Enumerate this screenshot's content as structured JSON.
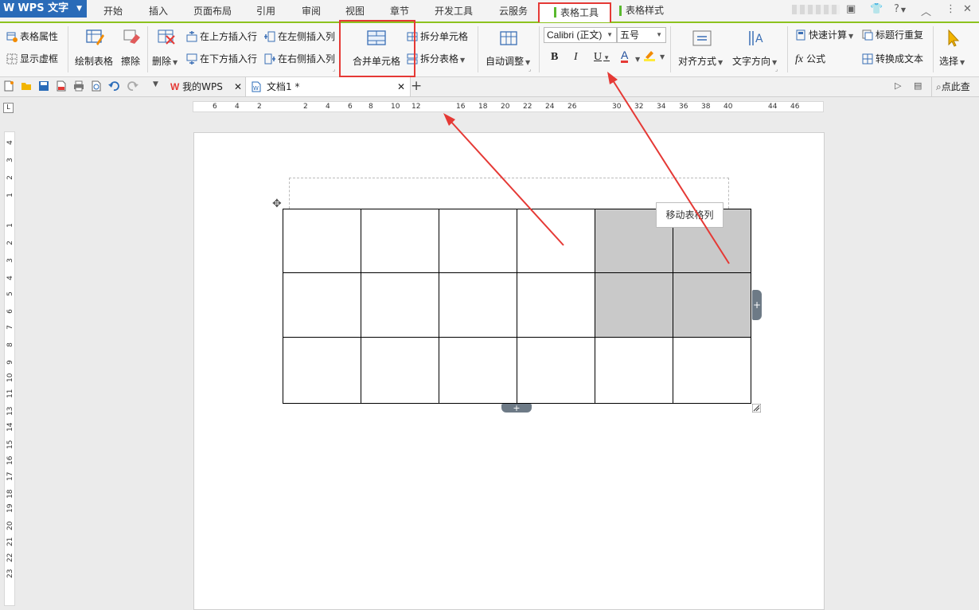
{
  "app": {
    "name": "WPS 文字",
    "logo_letter": "W",
    "accent_color": "#2a6bb8",
    "ribbon_accent": "#8dc21f"
  },
  "menu_tabs": [
    "开始",
    "插入",
    "页面布局",
    "引用",
    "审阅",
    "视图",
    "章节",
    "开发工具",
    "云服务"
  ],
  "context_tabs": {
    "table_tools": "表格工具",
    "table_style": "表格样式"
  },
  "window_controls": {
    "help": "?"
  },
  "ribbon": {
    "table_properties": "表格属性",
    "show_gridlines": "显示虚框",
    "draw_table": "绘制表格",
    "erase": "擦除",
    "delete": "删除",
    "insert_row_above": "在上方插入行",
    "insert_row_below": "在下方插入行",
    "insert_col_left": "在左侧插入列",
    "insert_col_right": "在右侧插入列",
    "merge_cells": "合并单元格",
    "split_cells": "拆分单元格",
    "split_table": "拆分表格",
    "auto_fit": "自动调整",
    "font_name": "Calibri (正文)",
    "font_size": "五号",
    "bold": "B",
    "italic": "I",
    "underline": "U",
    "font_color": "A",
    "align": "对齐方式",
    "text_direction": "文字方向",
    "quick_calc": "快速计算",
    "header_repeat": "标题行重复",
    "formula_fx": "fx",
    "formula": "公式",
    "convert_text": "转换成文本",
    "select": "选择"
  },
  "doc_tabs": {
    "my_wps": "我的WPS",
    "doc1": "文档1 *",
    "add": "+",
    "search": "点此查"
  },
  "ruler": {
    "h_ticks": [
      "6",
      "4",
      "2",
      "2",
      "4",
      "6",
      "8",
      "10",
      "12",
      "16",
      "18",
      "20",
      "22",
      "24",
      "26",
      "30",
      "32",
      "34",
      "36",
      "38",
      "40",
      "44",
      "46"
    ],
    "v_ticks": [
      "4",
      "3",
      "2",
      "1",
      "1",
      "2",
      "3",
      "4",
      "5",
      "6",
      "7",
      "8",
      "9",
      "10",
      "11",
      "13",
      "14",
      "15",
      "16",
      "17",
      "18",
      "19",
      "20",
      "21",
      "22",
      "23"
    ]
  },
  "table": {
    "rows": 3,
    "cols": 6,
    "selected_cells": [
      [
        0,
        4
      ],
      [
        0,
        5
      ],
      [
        1,
        4
      ],
      [
        1,
        5
      ]
    ]
  },
  "tooltip": "移动表格列",
  "add_buttons": {
    "col": "+",
    "row": "+"
  }
}
